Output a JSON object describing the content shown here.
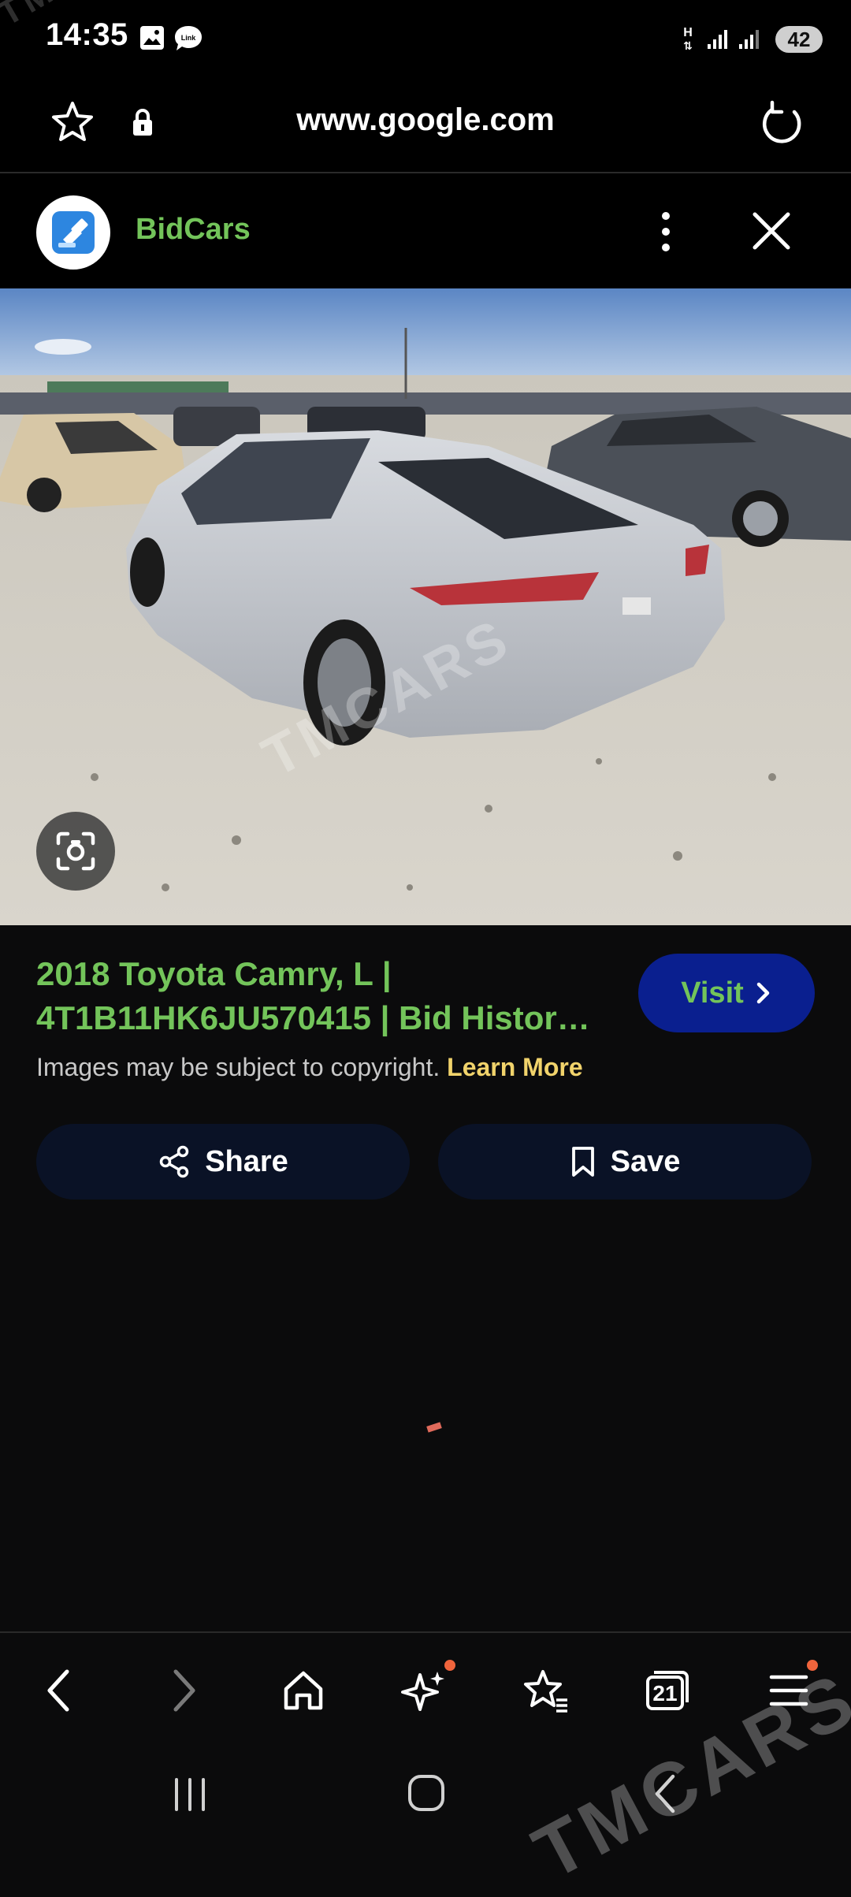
{
  "status_bar": {
    "time": "14:35",
    "network_type": "H",
    "battery": "42",
    "icons": [
      "image-icon",
      "link-icon",
      "signal-icon",
      "signal-icon"
    ]
  },
  "url_bar": {
    "url": "www.google.com"
  },
  "source": {
    "name": "BidCars",
    "name_color": "#73c45a"
  },
  "result": {
    "title_line1": "2018 Toyota Camry, L |",
    "title_line2": "4T1B11HK6JU570415 | Bid Histor…",
    "visit_label": "Visit",
    "copyright_text": "Images may be subject to copyright.",
    "learn_more": "Learn More",
    "share_label": "Share",
    "save_label": "Save"
  },
  "toolbar": {
    "tabs_count": "21"
  },
  "watermark": {
    "text": "TMCARS"
  },
  "colors": {
    "accent_green": "#73c45a",
    "visit_bg": "#0a1f8f",
    "learn_more": "#f1d36b",
    "notification_dot": "#f0643c"
  }
}
